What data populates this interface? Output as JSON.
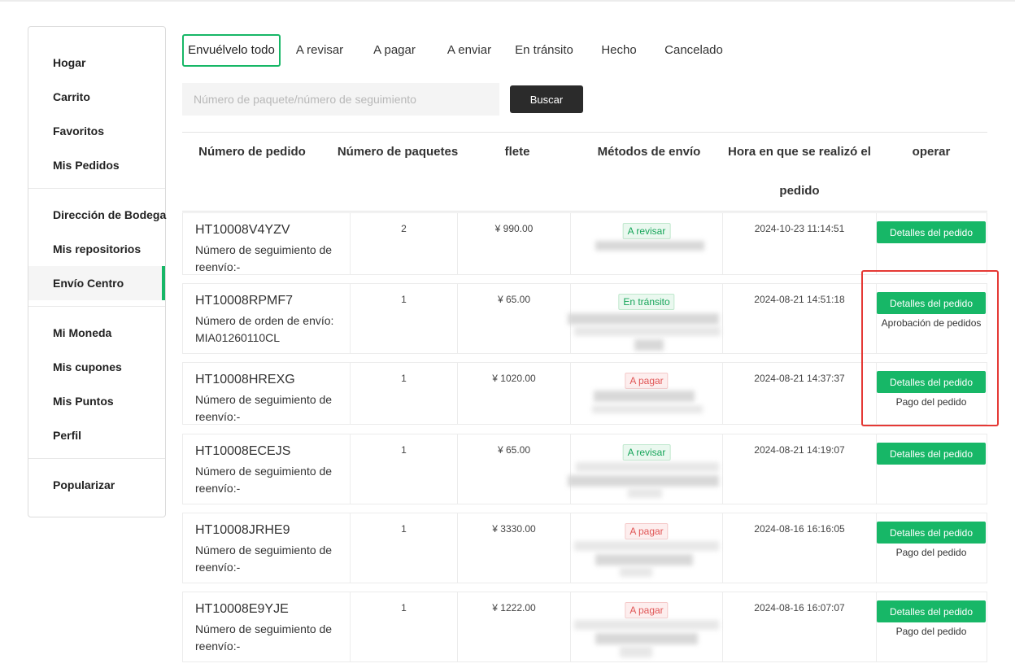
{
  "sidebar": {
    "items": [
      {
        "label": "Hogar"
      },
      {
        "label": "Carrito"
      },
      {
        "label": "Favoritos"
      },
      {
        "label": "Mis Pedidos"
      },
      {
        "label": "Dirección de Bodega"
      },
      {
        "label": "Mis repositorios"
      },
      {
        "label": "Envío Centro"
      },
      {
        "label": "Mi Moneda"
      },
      {
        "label": "Mis cupones"
      },
      {
        "label": "Mis Puntos"
      },
      {
        "label": "Perfil"
      },
      {
        "label": "Popularizar"
      }
    ]
  },
  "tabs": [
    {
      "label": "Envuélvelo todo"
    },
    {
      "label": "A revisar"
    },
    {
      "label": "A pagar"
    },
    {
      "label": "A enviar"
    },
    {
      "label": "En tránsito"
    },
    {
      "label": "Hecho"
    },
    {
      "label": "Cancelado"
    }
  ],
  "search": {
    "placeholder": "Número de paquete/número de seguimiento",
    "button_label": "Buscar"
  },
  "table": {
    "headers": {
      "order_no": "Número de pedido",
      "packages": "Número de paquetes",
      "freight": "flete",
      "shipping": "Métodos de envío",
      "time_line1": "Hora en que se realizó el",
      "time_line2": "pedido",
      "operate": "operar"
    },
    "detail_label": "Detalles del pedido",
    "rows": [
      {
        "order_no": "HT10008V4YZV",
        "tracking": "Número de seguimiento de reenvío:-",
        "packages": "2",
        "freight": "¥ 990.00",
        "status": "A revisar",
        "time": "2024-10-23 11:14:51",
        "extra": ""
      },
      {
        "order_no": "HT10008RPMF7",
        "tracking": "Número de orden de envío: MIA01260110CL",
        "packages": "1",
        "freight": "¥ 65.00",
        "status": "En tránsito",
        "time": "2024-08-21 14:51:18",
        "extra": "Aprobación de pedidos"
      },
      {
        "order_no": "HT10008HREXG",
        "tracking": "Número de seguimiento de reenvío:-",
        "packages": "1",
        "freight": "¥ 1020.00",
        "status": "A pagar",
        "time": "2024-08-21 14:37:37",
        "extra": "Pago del pedido"
      },
      {
        "order_no": "HT10008ECEJS",
        "tracking": "Número de seguimiento de reenvío:-",
        "packages": "1",
        "freight": "¥ 65.00",
        "status": "A revisar",
        "time": "2024-08-21 14:19:07",
        "extra": ""
      },
      {
        "order_no": "HT10008JRHE9",
        "tracking": "Número de seguimiento de reenvío:-",
        "packages": "1",
        "freight": "¥ 3330.00",
        "status": "A pagar",
        "time": "2024-08-16 16:16:05",
        "extra": "Pago del pedido"
      },
      {
        "order_no": "HT10008E9YJE",
        "tracking": "Número de seguimiento de reenvío:-",
        "packages": "1",
        "freight": "¥ 1222.00",
        "status": "A pagar",
        "time": "2024-08-16 16:07:07",
        "extra": "Pago del pedido"
      }
    ]
  },
  "colors": {
    "accent": "#17b767",
    "status_green": "#17a55a",
    "status_red": "#e05555",
    "highlight": "#e53935"
  }
}
